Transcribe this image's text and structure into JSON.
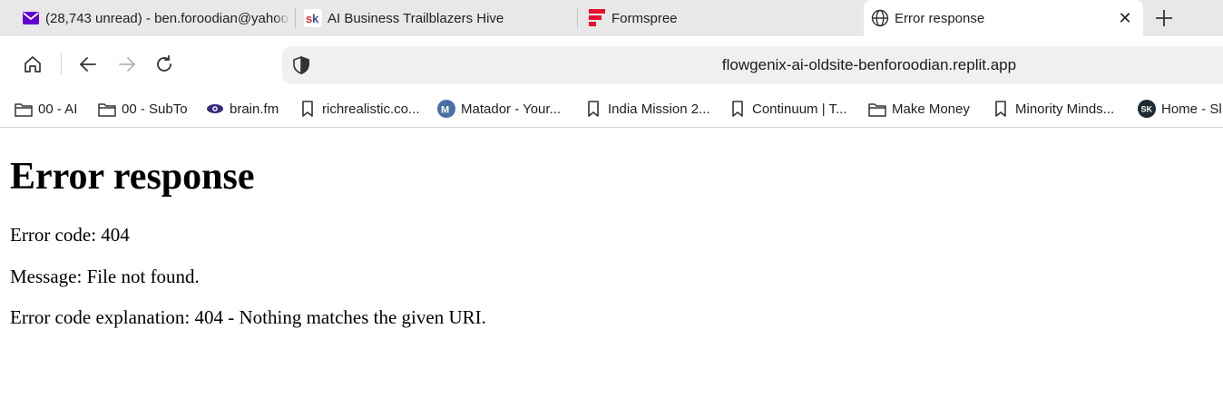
{
  "tabs": [
    {
      "title": "(28,743 unread) - ben.foroodian@yahoo",
      "icon": "yahoo-mail-icon",
      "active": false
    },
    {
      "title": "AI Business Trailblazers Hive",
      "icon": "sk-logo-icon",
      "active": false
    },
    {
      "title": "Formspree",
      "icon": "formspree-icon",
      "active": false
    },
    {
      "title": "Error response",
      "icon": "globe-icon",
      "active": true
    }
  ],
  "tab_close_glyph": "✕",
  "address_bar": {
    "url": "flowgenix-ai-oldsite-benforoodian.replit.app"
  },
  "bookmarks": [
    {
      "label": "00 - AI",
      "icon": "folder-icon"
    },
    {
      "label": "00 - SubTo",
      "icon": "folder-icon"
    },
    {
      "label": "brain.fm",
      "icon": "brainfm-icon"
    },
    {
      "label": "richrealistic.co...",
      "icon": "bookmark-icon"
    },
    {
      "label": "Matador - Your...",
      "icon": "matador-icon"
    },
    {
      "label": "India Mission 2...",
      "icon": "bookmark-icon"
    },
    {
      "label": "Continuum | T...",
      "icon": "bookmark-icon"
    },
    {
      "label": "Make Money",
      "icon": "folder-icon"
    },
    {
      "label": "Minority Minds...",
      "icon": "bookmark-icon"
    },
    {
      "label": "Home - Sl",
      "icon": "sk-dark-icon"
    }
  ],
  "page": {
    "heading": "Error response",
    "error_code": "Error code: 404",
    "message": "Message: File not found.",
    "explanation": "Error code explanation: 404 - Nothing matches the given URI."
  },
  "colors": {
    "tabstrip_bg": "#e8e8e8",
    "address_bg": "#f0f0f0",
    "yahoo_purple": "#6001d2",
    "formspree_red": "#e5122e",
    "sk_red": "#d6293a",
    "sk_blue": "#3b4a9c"
  }
}
